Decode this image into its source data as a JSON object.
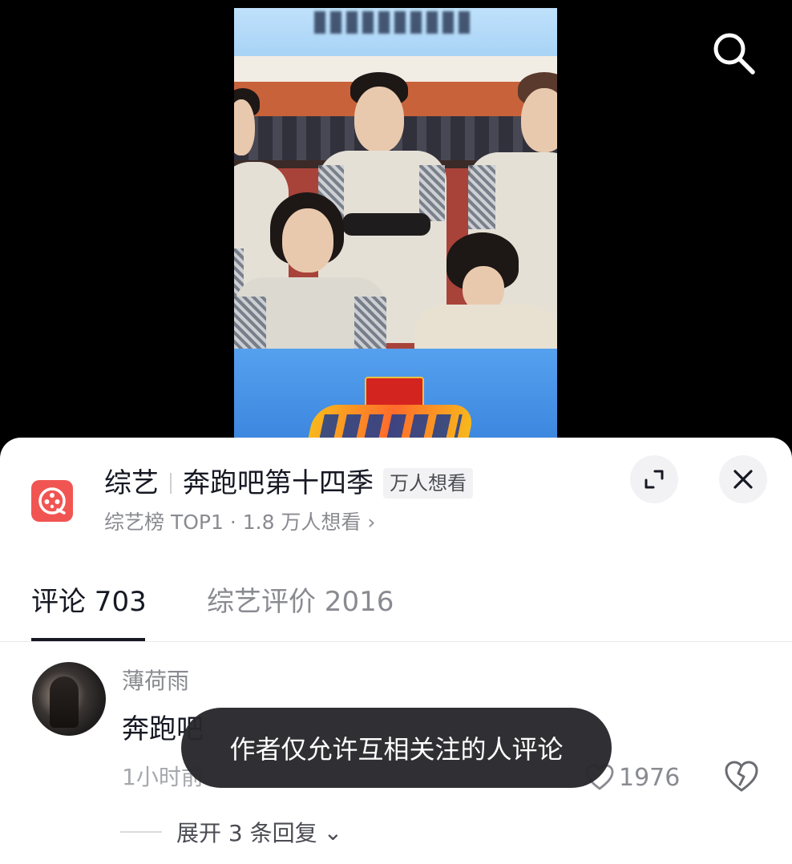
{
  "show": {
    "category": "综艺",
    "title": "奔跑吧第十四季",
    "want_badge": "万人想看",
    "subtitle": "综艺榜 TOP1 · 1.8 万人想看",
    "subtitle_arrow": "›"
  },
  "tabs": [
    {
      "label": "评论 703",
      "active": true
    },
    {
      "label": "综艺评价 2016",
      "active": false
    }
  ],
  "comment": {
    "username": "薄荷雨",
    "text_visible": "奔跑吧",
    "time_visible": "1小时前",
    "likes": "1976",
    "replies_label": "展开 3 条回复",
    "replies_arrow": "⌄"
  },
  "toast": {
    "message": "作者仅允许互相关注的人评论"
  },
  "icons": {
    "search": "search-icon",
    "expand": "expand-icon",
    "close": "close-icon",
    "show": "film-reel-icon",
    "like": "heart-outline-icon",
    "dislike": "broken-heart-icon"
  },
  "colors": {
    "accent_red": "#f15552",
    "text_primary": "#161823",
    "text_secondary": "#8a8b91",
    "toast_bg": "#28282c"
  }
}
